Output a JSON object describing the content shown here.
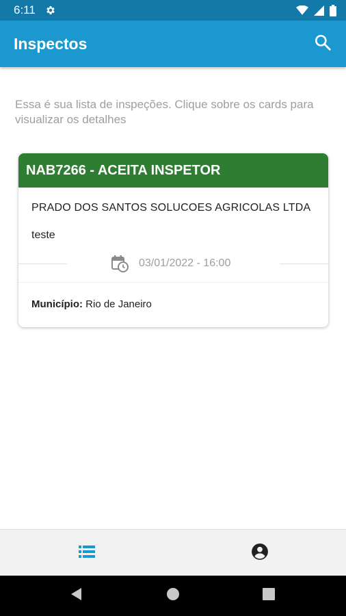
{
  "status_bar": {
    "time": "6:11",
    "icons": [
      "settings-gear-icon",
      "wifi-icon",
      "cell-signal-icon",
      "battery-icon"
    ]
  },
  "app_bar": {
    "title": "Inspectos",
    "search_icon": "search-icon"
  },
  "intro_text": "Essa é sua lista de inspeções. Clique sobre os cards para visualizar os detalhes",
  "inspections": [
    {
      "header": "NAB7266 - ACEITA INSPETOR",
      "company": "PRADO DOS SANTOS SOLUCOES AGRICOLAS LTDA",
      "description": "teste",
      "datetime": "03/01/2022 - 16:00",
      "city_label": "Município:",
      "city": " Rio de Janeiro",
      "header_color": "#2e7d32"
    }
  ],
  "bottom_nav": {
    "items": [
      {
        "icon": "list-icon",
        "active": true
      },
      {
        "icon": "account-circle-icon",
        "active": false
      }
    ],
    "active_color": "#1b98cf"
  },
  "system_nav": [
    "back-icon",
    "home-icon",
    "recents-icon"
  ],
  "colors": {
    "status_bar": "#1379a8",
    "app_bar": "#1b98cf",
    "card_header": "#2e7d32"
  }
}
